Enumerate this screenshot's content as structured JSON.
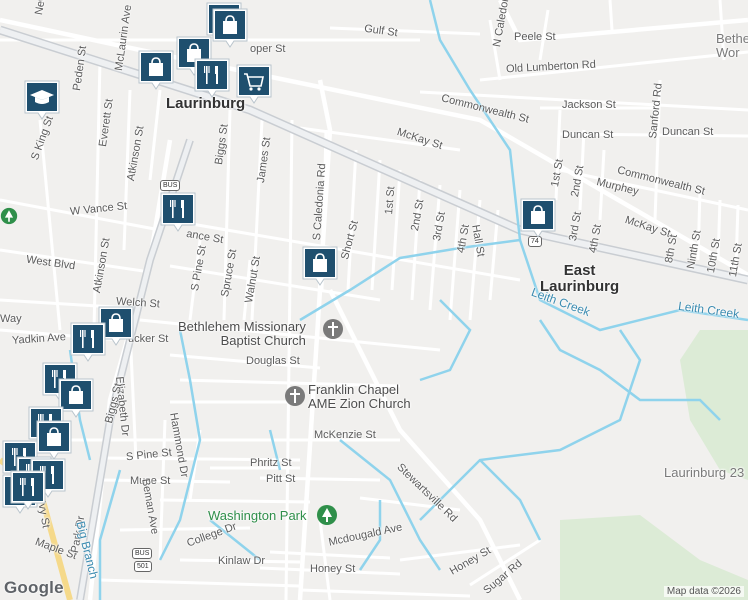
{
  "map": {
    "places": {
      "laurinburg": "Laurinburg",
      "east_laurinburg": "East\nLaurinburg",
      "laurinburg_23": "Laurinburg 23",
      "bethel_frag": "Bethe\nWor",
      "bethlehem_church": "Bethlehem Missionary\nBaptist Church",
      "franklin_chapel": "Franklin Chapel\nAME Zion Church",
      "washington_park": "Washington Park"
    },
    "streets": {
      "gulf": "Gulf St",
      "peele": "Peele St",
      "old_lumberton": "Old Lumberton Rd",
      "jackson": "Jackson St",
      "duncan_e": "Duncan St",
      "duncan_w": "Duncan St",
      "commonwealth_n": "Commonwealth St",
      "commonwealth_s": "Commonwealth St",
      "mckay_w": "McKay St",
      "mckay_e": "McKay St",
      "murphey": "Murphey",
      "cooper": "oper St",
      "peden": "Peden St",
      "mclaurin": "McLaurin Ave",
      "everett": "Everett St",
      "s_king": "S King St",
      "atkinson": "Atkinson St",
      "biggs_n": "Biggs St",
      "james": "James St",
      "s_caledonia": "S Caledonia Rd",
      "n_caledonia": "N Caledonia",
      "short": "Short St",
      "first": "1st St",
      "second": "2nd St",
      "third": "3rd St",
      "fourth": "4th St",
      "hall": "Hall St",
      "first_e": "1st St",
      "second_e": "2nd St",
      "third_e": "3rd St",
      "fourth_e": "4th St",
      "sanford": "Sanford Rd",
      "eighth": "8th St",
      "ninth": "Ninth St",
      "tenth": "10th St",
      "eleventh": "11th St",
      "w_vance": "W Vance St",
      "vance": "ance St",
      "west_blvd": "West Blvd",
      "s_pine_n": "S Pine St",
      "spruce": "Spruce St",
      "walnut": "Walnut St",
      "welch": "Welch St",
      "yadkin": "Yadkin Ave",
      "tucker": "ucker St",
      "atkinson_s": "Atkinson St",
      "douglas": "Douglas St",
      "elizabeth": "Elizabeth Dr",
      "hammond": "Hammond Dr",
      "mckenzie": "McKenzie St",
      "s_pine_s": "S Pine St",
      "phritz": "Phritz St",
      "pitt": "Pitt St",
      "muse": "Muse St",
      "beman": "Beman Ave",
      "biggs_s": "Biggs St",
      "stewartsville": "Stewartsville Rd",
      "college": "College Dr",
      "mcdougald": "Mcdougald Ave",
      "kinlaw": "Kinlaw Dr",
      "honey_w": "Honey St",
      "honey_e": "Honey St",
      "sugar": "Sugar Rd",
      "maple": "Maple St",
      "park": "Park Dr",
      "ivy": "Ivy St",
      "way": "Way",
      "new": "New",
      "leith_w": "Leith Creek",
      "leith_e": "Leith Creek",
      "big_branch": "Big Branch"
    },
    "shields": {
      "bus_n": "BUS",
      "us74": "74",
      "bus_s": "BUS",
      "us501": "501"
    },
    "attribution": "Map data ©2026",
    "logo": "Google",
    "colors": {
      "background": "#f1f0ee",
      "road": "#ffffff",
      "road_casing": "#d7d7d7",
      "major_road": "#c9cdd2",
      "water": "#8fd3ec",
      "park": "#c8e6c1",
      "pin": "#1f4f6e",
      "church": "#7a7a7a",
      "park_icon": "#2f8f4a"
    },
    "pins": [
      {
        "kind": "shopping",
        "icon": "shopping-bag-icon"
      },
      {
        "kind": "shopping",
        "icon": "shopping-bag-icon"
      },
      {
        "kind": "shopping",
        "icon": "shopping-bag-icon"
      },
      {
        "kind": "shopping",
        "icon": "shopping-bag-icon"
      },
      {
        "kind": "restaurant",
        "icon": "fork-knife-icon"
      },
      {
        "kind": "grocery",
        "icon": "shopping-cart-icon"
      },
      {
        "kind": "education",
        "icon": "graduation-cap-icon"
      },
      {
        "kind": "restaurant",
        "icon": "fork-knife-icon"
      },
      {
        "kind": "shopping",
        "icon": "shopping-bag-icon"
      },
      {
        "kind": "shopping",
        "icon": "shopping-bag-icon"
      },
      {
        "kind": "shopping",
        "icon": "shopping-bag-icon"
      },
      {
        "kind": "restaurant",
        "icon": "fork-knife-icon"
      },
      {
        "kind": "restaurant",
        "icon": "fork-knife-icon"
      },
      {
        "kind": "shopping",
        "icon": "shopping-bag-icon"
      },
      {
        "kind": "restaurant",
        "icon": "fork-knife-icon"
      },
      {
        "kind": "shopping",
        "icon": "shopping-bag-icon"
      },
      {
        "kind": "restaurant",
        "icon": "fork-knife-icon"
      },
      {
        "kind": "restaurant",
        "icon": "fork-knife-icon"
      },
      {
        "kind": "restaurant",
        "icon": "fork-knife-icon"
      },
      {
        "kind": "restaurant",
        "icon": "fork-knife-icon"
      },
      {
        "kind": "restaurant",
        "icon": "fork-knife-icon"
      }
    ]
  }
}
